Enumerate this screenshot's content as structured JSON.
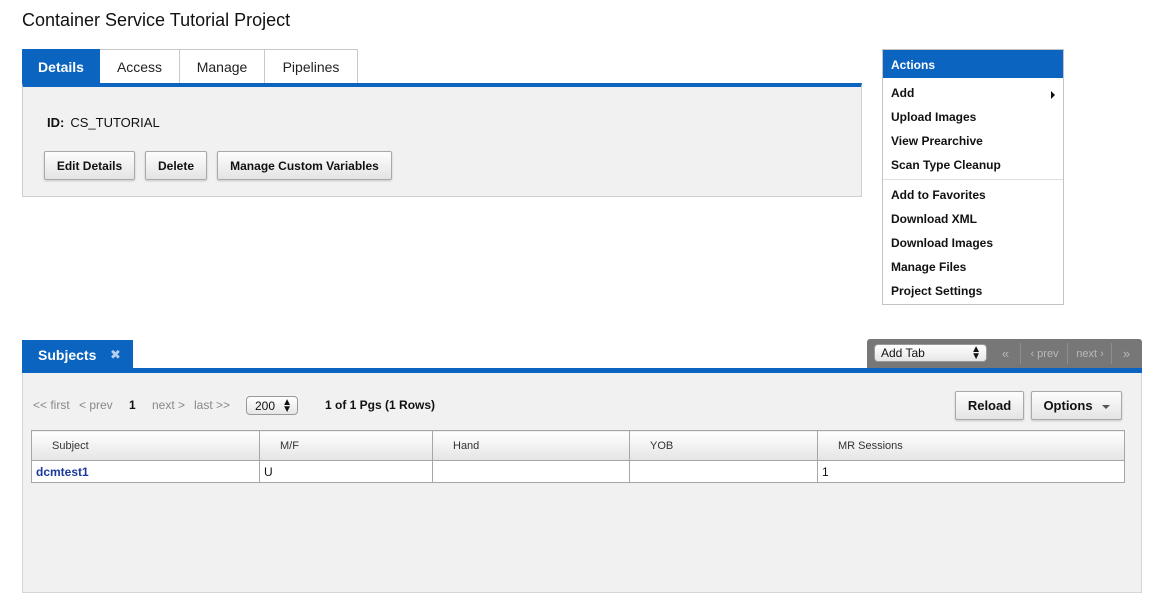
{
  "page": {
    "title": "Container Service Tutorial Project"
  },
  "tabs": [
    {
      "label": "Details",
      "active": true
    },
    {
      "label": "Access"
    },
    {
      "label": "Manage"
    },
    {
      "label": "Pipelines"
    }
  ],
  "details": {
    "id_label": "ID:",
    "id_value": "CS_TUTORIAL",
    "buttons": {
      "edit": "Edit Details",
      "delete": "Delete",
      "custom_vars": "Manage Custom Variables"
    }
  },
  "actions": {
    "header": "Actions",
    "items": [
      {
        "label": "Add"
      },
      {
        "label": "Upload Images"
      },
      {
        "label": "View Prearchive"
      },
      {
        "label": "Scan Type Cleanup"
      },
      {
        "label": "Add to Favorites"
      },
      {
        "label": "Download XML"
      },
      {
        "label": "Download Images"
      },
      {
        "label": "Manage Files"
      },
      {
        "label": "Project Settings"
      }
    ]
  },
  "subjects": {
    "tab_label": "Subjects",
    "close_glyph": "✖",
    "tab_control": {
      "add_tab": "Add Tab",
      "first": "«",
      "prev": "‹ prev",
      "next": "next ›",
      "last": "»"
    },
    "pager": {
      "first": "<< first",
      "prev": "< prev",
      "current": "1",
      "next": "next >",
      "last": "last >>",
      "page_size": "200",
      "info": "1 of 1 Pgs (1 Rows)"
    },
    "buttons": {
      "reload": "Reload",
      "options": "Options"
    },
    "columns": [
      "Subject",
      "M/F",
      "Hand",
      "YOB",
      "MR Sessions"
    ],
    "rows": [
      {
        "subject": "dcmtest1",
        "mf": "U",
        "hand": "",
        "yob": "",
        "mr_sessions": "1"
      }
    ]
  },
  "colors": {
    "accent": "#0b64bf",
    "link": "#1a3a9e",
    "panel": "#f1f1f1"
  }
}
